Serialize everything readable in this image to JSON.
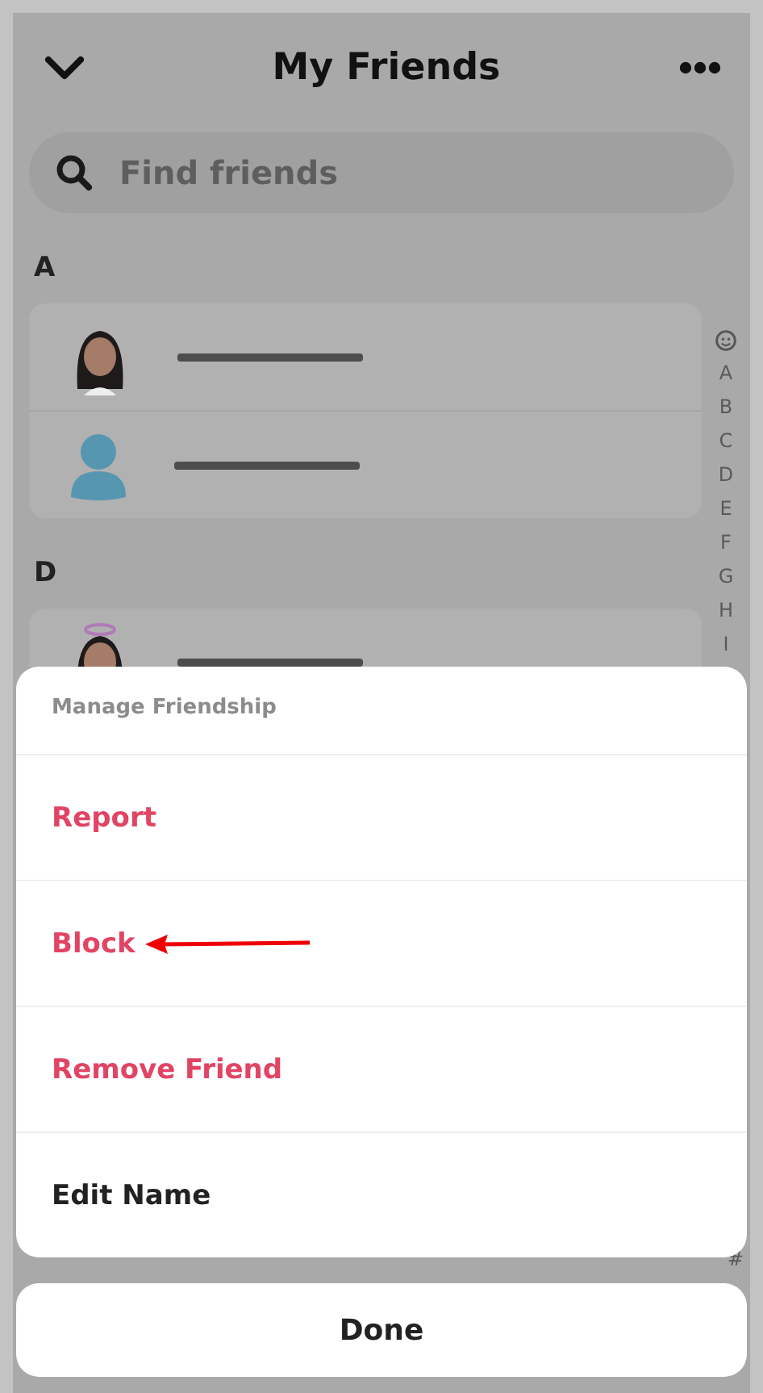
{
  "header": {
    "title": "My Friends"
  },
  "search": {
    "placeholder": "Find friends"
  },
  "sections": [
    {
      "letter": "A",
      "friends": [
        {
          "kind": "bitmoji"
        },
        {
          "kind": "default"
        }
      ]
    },
    {
      "letter": "D",
      "friends": [
        {
          "kind": "bitmoji_halo"
        }
      ]
    }
  ],
  "index": [
    "A",
    "B",
    "C",
    "D",
    "E",
    "F",
    "G",
    "H",
    "I"
  ],
  "index_end": "#",
  "sheet": {
    "title": "Manage Friendship",
    "actions": [
      {
        "label": "Report",
        "kind": "destructive",
        "annotated": false
      },
      {
        "label": "Block",
        "kind": "destructive",
        "annotated": true
      },
      {
        "label": "Remove Friend",
        "kind": "destructive",
        "annotated": false
      },
      {
        "label": "Edit Name",
        "kind": "normal",
        "annotated": false
      }
    ]
  },
  "done": "Done"
}
